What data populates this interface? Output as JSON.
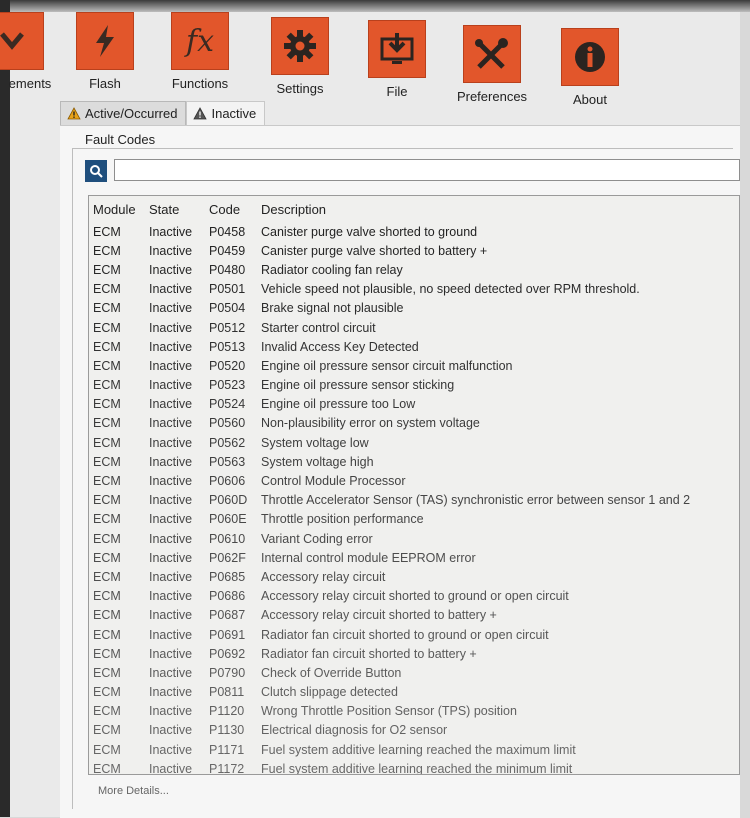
{
  "toolbar": {
    "items": [
      {
        "label": "ements",
        "icon": "measurements-icon"
      },
      {
        "label": "Flash",
        "icon": "flash-icon"
      },
      {
        "label": "Functions",
        "icon": "fx-icon",
        "glyph": "fx"
      },
      {
        "label": "Settings",
        "icon": "gear-icon"
      },
      {
        "label": "File",
        "icon": "download-icon"
      },
      {
        "label": "Preferences",
        "icon": "tools-icon"
      },
      {
        "label": "About",
        "icon": "info-icon"
      }
    ],
    "accent": "#e2562b"
  },
  "tabs": [
    {
      "label": "Active/Occurred",
      "icon": "warning-icon"
    },
    {
      "label": "Inactive",
      "icon": "warning-icon"
    }
  ],
  "fault_codes": {
    "section_title": "Fault Codes",
    "search_value": "",
    "columns": [
      "Module",
      "State",
      "Code",
      "Description"
    ],
    "rows": [
      [
        "ECM",
        "Inactive",
        "P0458",
        "Canister purge valve shorted to ground"
      ],
      [
        "ECM",
        "Inactive",
        "P0459",
        "Canister purge valve shorted to battery +"
      ],
      [
        "ECM",
        "Inactive",
        "P0480",
        "Radiator cooling fan relay"
      ],
      [
        "ECM",
        "Inactive",
        "P0501",
        "Vehicle speed not plausible, no speed detected over RPM threshold."
      ],
      [
        "ECM",
        "Inactive",
        "P0504",
        "Brake signal not plausible"
      ],
      [
        "ECM",
        "Inactive",
        "P0512",
        "Starter control circuit"
      ],
      [
        "ECM",
        "Inactive",
        "P0513",
        "Invalid Access Key Detected"
      ],
      [
        "ECM",
        "Inactive",
        "P0520",
        "Engine oil pressure sensor circuit malfunction"
      ],
      [
        "ECM",
        "Inactive",
        "P0523",
        "Engine oil pressure sensor sticking"
      ],
      [
        "ECM",
        "Inactive",
        "P0524",
        "Engine oil pressure too Low"
      ],
      [
        "ECM",
        "Inactive",
        "P0560",
        "Non-plausibility error on system voltage"
      ],
      [
        "ECM",
        "Inactive",
        "P0562",
        "System voltage low"
      ],
      [
        "ECM",
        "Inactive",
        "P0563",
        "System voltage high"
      ],
      [
        "ECM",
        "Inactive",
        "P0606",
        "Control Module Processor"
      ],
      [
        "ECM",
        "Inactive",
        "P060D",
        "Throttle Accelerator Sensor (TAS) synchronistic error between sensor 1 and 2"
      ],
      [
        "ECM",
        "Inactive",
        "P060E",
        "Throttle position performance"
      ],
      [
        "ECM",
        "Inactive",
        "P0610",
        "Variant Coding error"
      ],
      [
        "ECM",
        "Inactive",
        "P062F",
        "Internal control module EEPROM error"
      ],
      [
        "ECM",
        "Inactive",
        "P0685",
        "Accessory relay circuit"
      ],
      [
        "ECM",
        "Inactive",
        "P0686",
        "Accessory relay circuit shorted to ground or open circuit"
      ],
      [
        "ECM",
        "Inactive",
        "P0687",
        "Accessory relay circuit shorted to battery +"
      ],
      [
        "ECM",
        "Inactive",
        "P0691",
        "Radiator fan circuit shorted to ground or open circuit"
      ],
      [
        "ECM",
        "Inactive",
        "P0692",
        "Radiator fan circuit shorted to battery +"
      ],
      [
        "ECM",
        "Inactive",
        "P0790",
        "Check of Override Button"
      ],
      [
        "ECM",
        "Inactive",
        "P0811",
        "Clutch slippage detected"
      ],
      [
        "ECM",
        "Inactive",
        "P1120",
        "Wrong Throttle Position Sensor (TPS) position"
      ],
      [
        "ECM",
        "Inactive",
        "P1130",
        "Electrical diagnosis for O2 sensor"
      ],
      [
        "ECM",
        "Inactive",
        "P1171",
        "Fuel system additive learning reached the maximum limit"
      ],
      [
        "ECM",
        "Inactive",
        "P1172",
        "Fuel system additive learning reached the minimum limit"
      ]
    ],
    "more_details": "More Details..."
  }
}
